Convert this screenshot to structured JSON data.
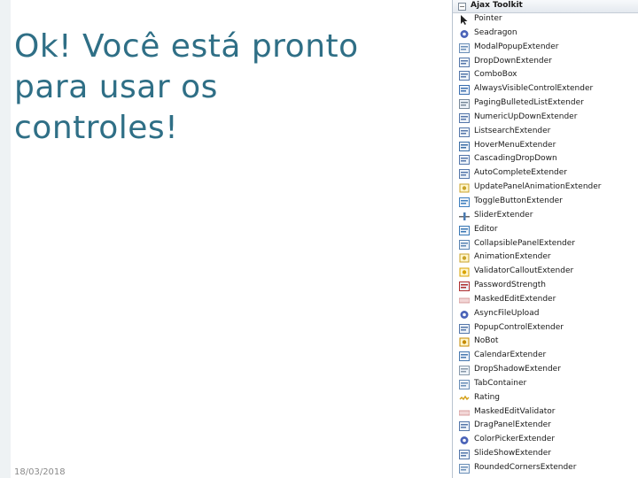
{
  "slide": {
    "title": "Ok! Você está pronto para usar os controles!",
    "date": "18/03/2018"
  },
  "toolbox": {
    "title": "Ajax Toolkit",
    "items": [
      {
        "label": "Pointer",
        "icon": "pointer-icon"
      },
      {
        "label": "Seadragon",
        "icon": "gear-icon"
      },
      {
        "label": "ModalPopupExtender",
        "icon": "window-icon"
      },
      {
        "label": "DropDownExtender",
        "icon": "dropdown-icon"
      },
      {
        "label": "ComboBox",
        "icon": "combobox-icon"
      },
      {
        "label": "AlwaysVisibleControlExtender",
        "icon": "pin-icon"
      },
      {
        "label": "PagingBulletedListExtender",
        "icon": "list-icon"
      },
      {
        "label": "NumericUpDownExtender",
        "icon": "numeric-icon"
      },
      {
        "label": "ListsearchExtender",
        "icon": "search-list-icon"
      },
      {
        "label": "HoverMenuExtender",
        "icon": "menu-icon"
      },
      {
        "label": "CascadingDropDown",
        "icon": "cascade-icon"
      },
      {
        "label": "AutoCompleteExtender",
        "icon": "autocomplete-icon"
      },
      {
        "label": "UpdatePanelAnimationExtender",
        "icon": "animation-icon"
      },
      {
        "label": "ToggleButtonExtender",
        "icon": "toggle-icon"
      },
      {
        "label": "SliderExtender",
        "icon": "slider-icon"
      },
      {
        "label": "Editor",
        "icon": "editor-icon"
      },
      {
        "label": "CollapsiblePanelExtender",
        "icon": "collapse-panel-icon"
      },
      {
        "label": "AnimationExtender",
        "icon": "animation-icon"
      },
      {
        "label": "ValidatorCalloutExtender",
        "icon": "callout-icon"
      },
      {
        "label": "PasswordStrength",
        "icon": "password-icon"
      },
      {
        "label": "MaskedEditExtender",
        "icon": "mask-icon"
      },
      {
        "label": "AsyncFileUpload",
        "icon": "gear-icon"
      },
      {
        "label": "PopupControlExtender",
        "icon": "popup-icon"
      },
      {
        "label": "NoBot",
        "icon": "nobot-icon"
      },
      {
        "label": "CalendarExtender",
        "icon": "calendar-icon"
      },
      {
        "label": "DropShadowExtender",
        "icon": "shadow-icon"
      },
      {
        "label": "TabContainer",
        "icon": "tab-icon"
      },
      {
        "label": "Rating",
        "icon": "rating-icon"
      },
      {
        "label": "MaskedEditValidator",
        "icon": "mask-icon"
      },
      {
        "label": "DragPanelExtender",
        "icon": "drag-icon"
      },
      {
        "label": "ColorPickerExtender",
        "icon": "gear-icon"
      },
      {
        "label": "SlideShowExtender",
        "icon": "slideshow-icon"
      },
      {
        "label": "RoundedCornersExtender",
        "icon": "rounded-icon"
      }
    ]
  }
}
